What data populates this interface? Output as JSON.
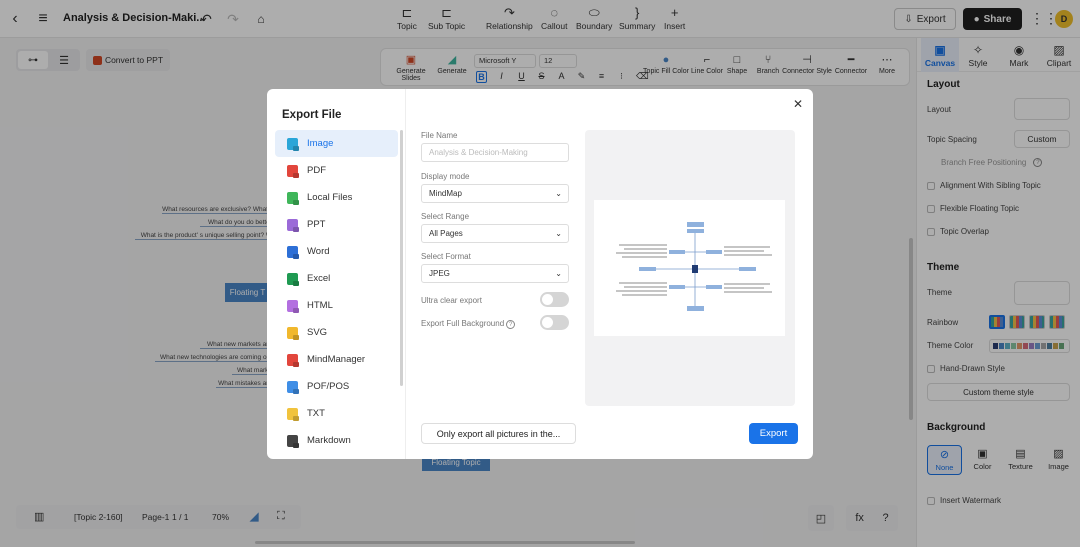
{
  "header": {
    "title": "Analysis & Decision-Maki...",
    "tools": [
      {
        "label": "Topic",
        "icon": "topic-icon"
      },
      {
        "label": "Sub Topic",
        "icon": "subtopic-icon"
      },
      {
        "label": "Relationship",
        "icon": "relationship-icon"
      },
      {
        "label": "Callout",
        "icon": "callout-icon"
      },
      {
        "label": "Boundary",
        "icon": "boundary-icon"
      },
      {
        "label": "Summary",
        "icon": "summary-icon"
      },
      {
        "label": "Insert",
        "icon": "plus-icon"
      }
    ],
    "export_label": "Export",
    "share_label": "Share",
    "avatar_initial": "D"
  },
  "canvas": {
    "convert_label": "Convert to PPT",
    "format_toolbar": {
      "generate_slides": "Generate Slides",
      "generate": "Generate",
      "font": "Microsoft Y",
      "size": "12",
      "topic_fill_color": "Topic Fill Color",
      "line_color": "Line Color",
      "shape": "Shape",
      "branch": "Branch",
      "connector_style": "Connector Style",
      "connector": "Connector",
      "more": "More"
    },
    "topics_top": [
      "What resources are exclusive? What r",
      "What do you do better",
      "What is the product'  s unique selling point? W"
    ],
    "topics_bottom": [
      "What new markets are",
      "What new technologies are coming out",
      "What marke",
      "What mistakes are"
    ],
    "floating_topic_left": "Floating T",
    "floating_topic_bottom": "Floating Topic",
    "status": {
      "topic_count": "[Topic 2-160]",
      "page_label": "Page-1",
      "page_value": "1 / 1",
      "zoom": "70%"
    }
  },
  "right_panel": {
    "tabs": [
      "Canvas",
      "Style",
      "Mark",
      "Clipart"
    ],
    "layout_title": "Layout",
    "layout_label": "Layout",
    "topic_spacing_label": "Topic Spacing",
    "topic_spacing_value": "Custom",
    "branch_free": "Branch Free Positioning",
    "align_sibling": "Alignment With Sibling Topic",
    "flexible_floating": "Flexible Floating Topic",
    "topic_overlap": "Topic Overlap",
    "theme_title": "Theme",
    "theme_label": "Theme",
    "rainbow_label": "Rainbow",
    "theme_color_label": "Theme Color",
    "hand_drawn": "Hand-Drawn Style",
    "custom_theme": "Custom theme style",
    "background_title": "Background",
    "bg_options": [
      "None",
      "Color",
      "Texture",
      "Image"
    ],
    "insert_watermark": "Insert Watermark"
  },
  "modal": {
    "title": "Export File",
    "formats": [
      {
        "label": "Image",
        "color": "#2aa6d8"
      },
      {
        "label": "PDF",
        "color": "#e2463c"
      },
      {
        "label": "Local Files",
        "color": "#3fb65a"
      },
      {
        "label": "PPT",
        "color": "#9b6ad8"
      },
      {
        "label": "Word",
        "color": "#2d6fd6"
      },
      {
        "label": "Excel",
        "color": "#1f9a52"
      },
      {
        "label": "HTML",
        "color": "#b36fe0"
      },
      {
        "label": "SVG",
        "color": "#f1b82d"
      },
      {
        "label": "MindManager",
        "color": "#e2463c"
      },
      {
        "label": "POF/POS",
        "color": "#3f8ee6"
      },
      {
        "label": "TXT",
        "color": "#f1c33d"
      },
      {
        "label": "Markdown",
        "color": "#444444"
      }
    ],
    "file_name_label": "File Name",
    "file_name_placeholder": "Analysis & Decision-Making",
    "display_mode_label": "Display mode",
    "display_mode_value": "MindMap",
    "select_range_label": "Select Range",
    "select_range_value": "All Pages",
    "select_format_label": "Select Format",
    "select_format_value": "JPEG",
    "ultra_clear_label": "Ultra clear export",
    "export_full_bg_label": "Export Full Background",
    "only_export_label": "Only export all pictures in the...",
    "export_label": "Export"
  }
}
